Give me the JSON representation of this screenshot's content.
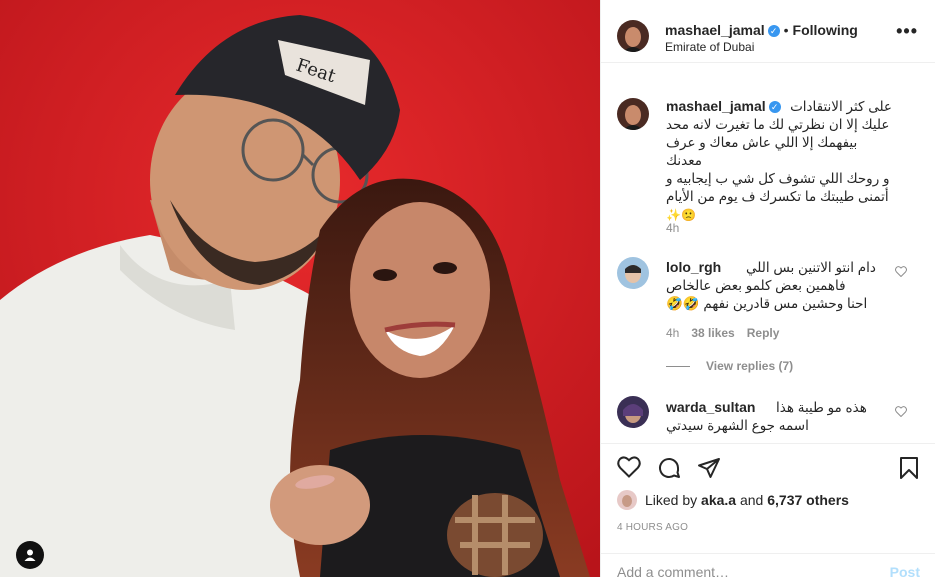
{
  "post": {
    "username": "mashael_jamal",
    "verified_mark": "✓",
    "separator": "•",
    "follow_status": "Following",
    "location": "Emirate of Dubai",
    "more_icon": "•••",
    "photo_icon": "user-tag-icon"
  },
  "caption": {
    "username": "mashael_jamal",
    "lines": [
      "على كثر الانتقادات",
      "عليك إلا ان نظرتي لك ما تغيرت لانه محد",
      "بيفهمك إلا اللي عاش معاك و عرف معدنك",
      "و روحك اللي تشوف كل شي ب إيجابيه و",
      "أتمنى طيبتك ما تكسرك ف يوم من الأيام"
    ],
    "emojis": "✨🙁",
    "time": "4h"
  },
  "comments": [
    {
      "username": "lolo_rgh",
      "lines": [
        "دام انتو الاتنين بس اللي",
        "فاهمين بعض كلمو بعض عالخاص",
        "احنا وحشين مس قادرين نفهم 🤣🤣"
      ],
      "time": "4h",
      "likes": "38 likes",
      "reply": "Reply",
      "view_replies": "View replies (7)"
    },
    {
      "username": "warda_sultan",
      "lines": [
        "هذه مو طيبة هذا",
        "اسمه جوع الشهرة سيدتي"
      ]
    }
  ],
  "actions": {
    "like_icon": "heart-icon",
    "comment_icon": "comment-icon",
    "share_icon": "share-icon",
    "save_icon": "bookmark-icon"
  },
  "likes": {
    "prefix": "Liked by",
    "user": "aka.a",
    "and": "and",
    "others": "6,737 others"
  },
  "timestamp": "4 HOURS AGO",
  "add_comment": {
    "placeholder": "Add a comment…",
    "post": "Post"
  },
  "colors": {
    "background_red": "#d61f24",
    "verified_blue": "#3897f0",
    "post_button": "#b2dffc"
  }
}
